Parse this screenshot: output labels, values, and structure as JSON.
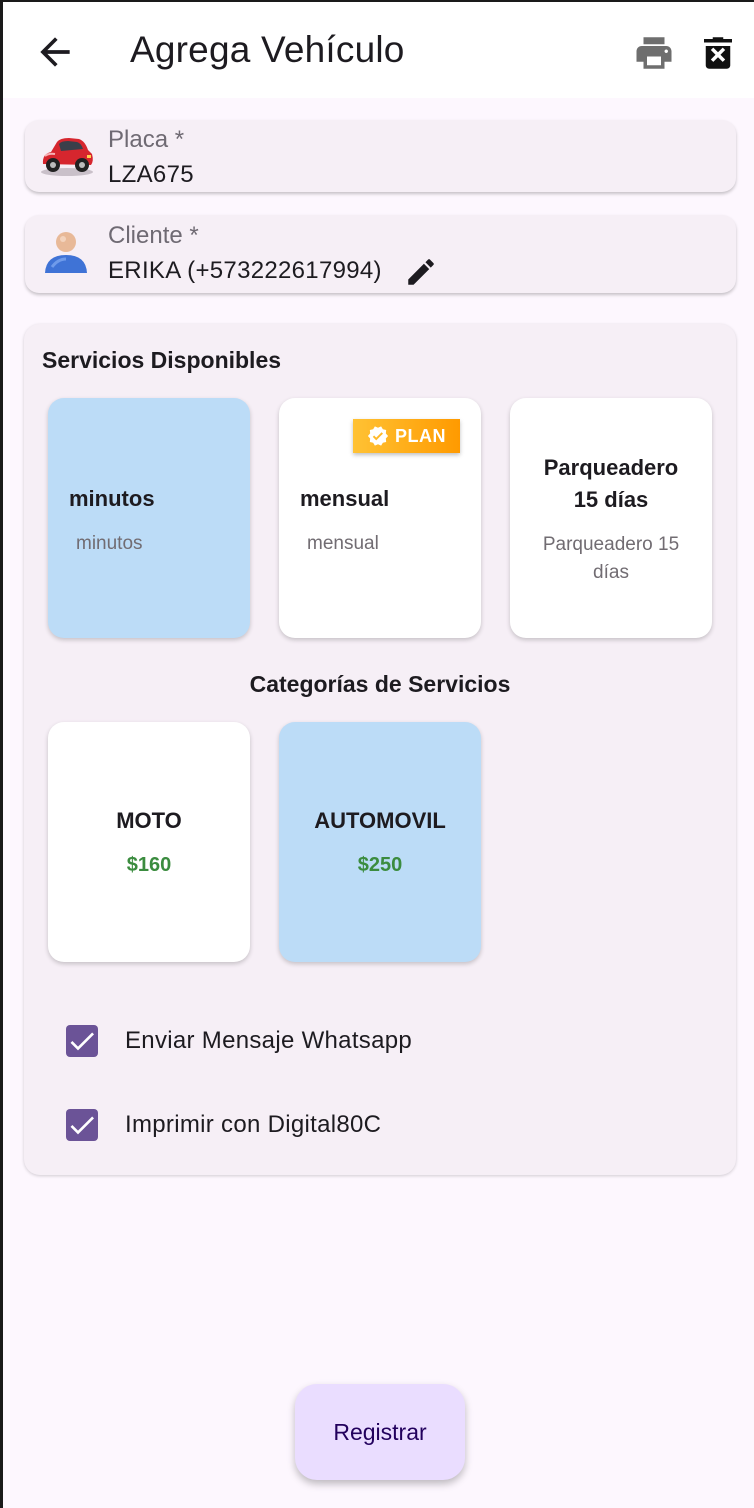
{
  "appbar": {
    "title": "Agrega Vehículo",
    "icons": [
      "arrow-back-icon",
      "print-icon",
      "delete-icon"
    ]
  },
  "placa": {
    "label": "Placa *",
    "value": "LZA675",
    "icon": "car-icon"
  },
  "cliente": {
    "label": "Cliente *",
    "value": "ERIKA (+573222617994)",
    "icon": "person-icon"
  },
  "servicios": {
    "title": "Servicios Disponibles",
    "items": [
      {
        "title": "minutos",
        "subtitle": "minutos",
        "selected": true
      },
      {
        "title": "mensual",
        "subtitle": "mensual",
        "badge": "PLAN",
        "selected": false
      },
      {
        "title_line1": "Parqueadero",
        "title_line2": "15 días",
        "subtitle_line1": "Parqueadero 15",
        "subtitle_line2": "días",
        "selected": false
      }
    ]
  },
  "categorias": {
    "title": "Categorías de Servicios",
    "items": [
      {
        "name": "MOTO",
        "price": "$160",
        "selected": false
      },
      {
        "name": "AUTOMOVIL",
        "price": "$250",
        "selected": true
      }
    ]
  },
  "options": {
    "whatsapp": {
      "label": "Enviar Mensaje Whatsapp",
      "checked": true
    },
    "imprimir": {
      "label": "Imprimir con Digital80C",
      "checked": true
    }
  },
  "register_label": "Registrar",
  "colors": {
    "selected_card": "#bcdcf7",
    "checkbox": "#6b5397",
    "price": "#3b8c3f",
    "badge": "#ffa500",
    "register_button": "#eaddff"
  }
}
